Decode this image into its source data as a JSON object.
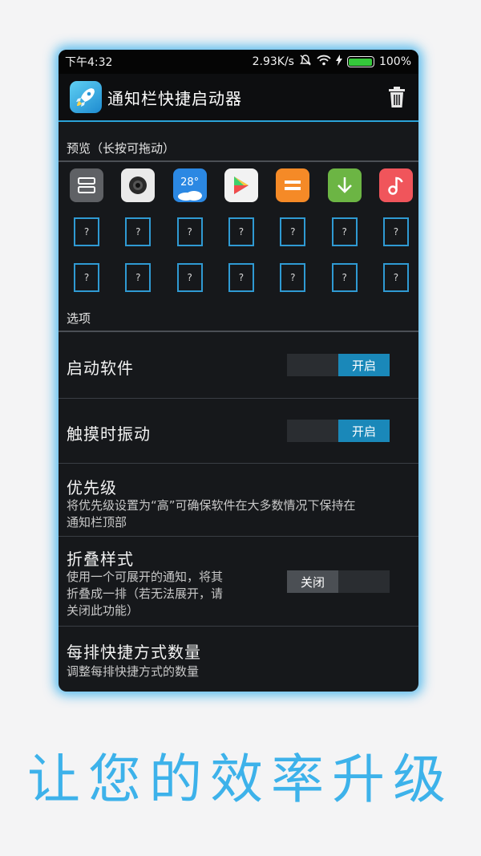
{
  "status_bar": {
    "time": "下午4:32",
    "net_speed": "2.93K/s",
    "battery": "100%"
  },
  "app_bar": {
    "title": "通知栏快捷启动器"
  },
  "preview": {
    "header": "预览（长按可拖动）",
    "icons": [
      {
        "name": "toggle-icon",
        "bg": "#5f6165"
      },
      {
        "name": "camera-icon",
        "bg": "#eaeaea"
      },
      {
        "name": "weather-icon",
        "bg": "#2b88e3",
        "label": "28°"
      },
      {
        "name": "play-store-icon",
        "bg": "#f2f2f2"
      },
      {
        "name": "calculator-icon",
        "bg": "#f58a27"
      },
      {
        "name": "download-icon",
        "bg": "#6cb544"
      },
      {
        "name": "music-icon",
        "bg": "#f0555b"
      }
    ],
    "placeholder": "?"
  },
  "options": {
    "header": "选项",
    "launch": {
      "title": "启动软件",
      "state": "开启"
    },
    "vibrate": {
      "title": "触摸时振动",
      "state": "开启"
    },
    "priority": {
      "title": "优先级",
      "desc_1": "将优先级设置为“高”可确保软件在大多数情况下保持在",
      "desc_2": "通知栏顶部"
    },
    "collapse": {
      "title": "折叠样式",
      "desc_1": "使用一个可展开的通知，将其",
      "desc_2": "折叠成一排（若无法展开，请",
      "desc_3": "关闭此功能）",
      "state": "关闭"
    },
    "per_row": {
      "title": "每排快捷方式数量",
      "desc": "调整每排快捷方式的数量"
    }
  },
  "banner": "让您的效率升级",
  "colors": {
    "accent": "#2aa3d8",
    "toggle_on": "#1a88b9",
    "banner": "#3db2ea"
  }
}
